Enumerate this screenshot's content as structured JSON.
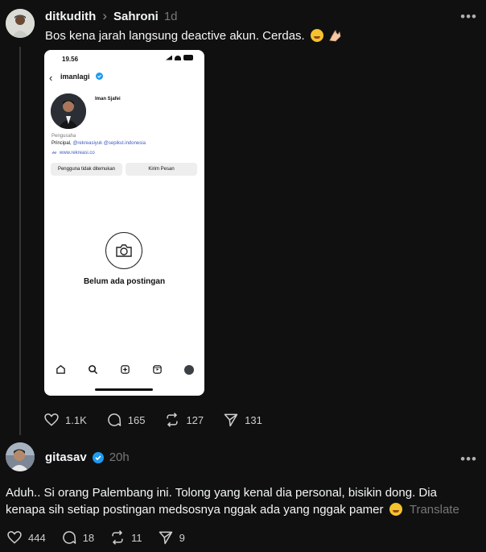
{
  "post1": {
    "author": "ditkudith",
    "reply_to": "Sahroni",
    "time": "1d",
    "text": "Bos kena jarah langsung deactive akun. Cerdas.",
    "more_label": "•••",
    "stats": {
      "likes": "1.1K",
      "replies": "165",
      "reposts": "127",
      "shares": "131"
    }
  },
  "embedded_screenshot": {
    "status_time": "19.56",
    "handle": "imanlagi",
    "name": "Iman Sjafei",
    "occupation": "Pengusaha",
    "bio_prefix": "Principal, ",
    "bio_tag_1": "@rekreasiyuk",
    "bio_tag_2": "@sepikul.indonesia",
    "website": "www.rekreasi.co",
    "button_left": "Pengguna tidak ditemukan",
    "button_right": "Kirim Pesan",
    "empty_state": "Belum ada postingan"
  },
  "post2": {
    "author": "gitasav",
    "time": "20h",
    "text": "Aduh.. Si orang Palembang ini. Tolong yang kenal dia personal, bisikin dong. Dia kenapa sih setiap postingan medsosnya nggak ada yang nggak pamer",
    "translate_label": "Translate",
    "more_label": "•••",
    "stats": {
      "likes": "444",
      "replies": "18",
      "reposts": "11",
      "shares": "9"
    }
  },
  "colors": {
    "background": "#101010",
    "text": "#f3f5f7",
    "muted": "#777777",
    "verified": "#1d9bf0"
  }
}
